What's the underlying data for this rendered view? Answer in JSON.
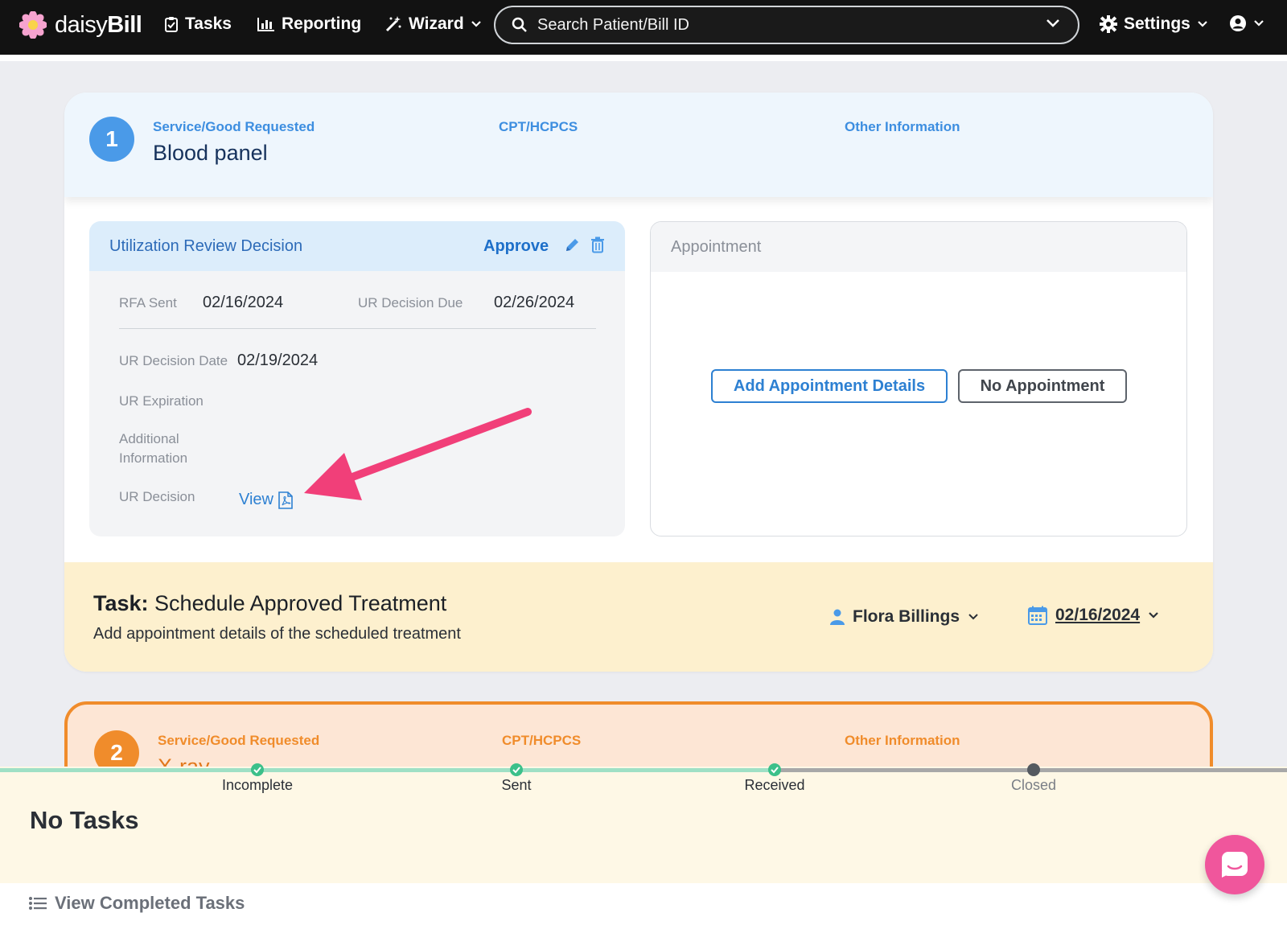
{
  "nav": {
    "brand": {
      "light": "daisy",
      "bold": "Bill"
    },
    "tasks_label": "Tasks",
    "reporting_label": "Reporting",
    "wizard_label": "Wizard",
    "search_placeholder": "Search Patient/Bill ID",
    "settings_label": "Settings"
  },
  "card1": {
    "number": "1",
    "service_label": "Service/Good Requested",
    "service_value": "Blood panel",
    "cpt_label": "CPT/HCPCS",
    "other_label": "Other Information",
    "ur": {
      "title": "Utilization Review Decision",
      "decision": "Approve",
      "rfa_sent_label": "RFA Sent",
      "rfa_sent_value": "02/16/2024",
      "due_label": "UR Decision Due",
      "due_value": "02/26/2024",
      "decision_date_label": "UR Decision Date",
      "decision_date_value": "02/19/2024",
      "expiration_label": "UR Expiration",
      "additional_label_1": "Additional",
      "additional_label_2": "Information",
      "ur_decision_label": "UR Decision",
      "view_label": "View"
    },
    "appointment": {
      "title": "Appointment",
      "add_button": "Add Appointment Details",
      "no_button": "No Appointment"
    },
    "task": {
      "prefix": "Task:",
      "title": "Schedule Approved Treatment",
      "description": "Add appointment details of the scheduled treatment",
      "assignee": "Flora Billings",
      "date": "02/16/2024"
    }
  },
  "card2": {
    "number": "2",
    "service_label": "Service/Good Requested",
    "service_value": "X-ray",
    "cpt_label": "CPT/HCPCS",
    "other_label": "Other Information"
  },
  "progress": {
    "steps": [
      {
        "label": "Incomplete",
        "status": "done"
      },
      {
        "label": "Sent",
        "status": "done"
      },
      {
        "label": "Received",
        "status": "done"
      },
      {
        "label": "Closed",
        "status": "pending"
      }
    ]
  },
  "bottom": {
    "no_tasks": "No Tasks",
    "view_completed": "View Completed Tasks"
  },
  "colors": {
    "primary_blue": "#2d80d2",
    "accent_pink": "#f0569c",
    "orange": "#f08c2b",
    "step_green": "#3cc08a"
  }
}
